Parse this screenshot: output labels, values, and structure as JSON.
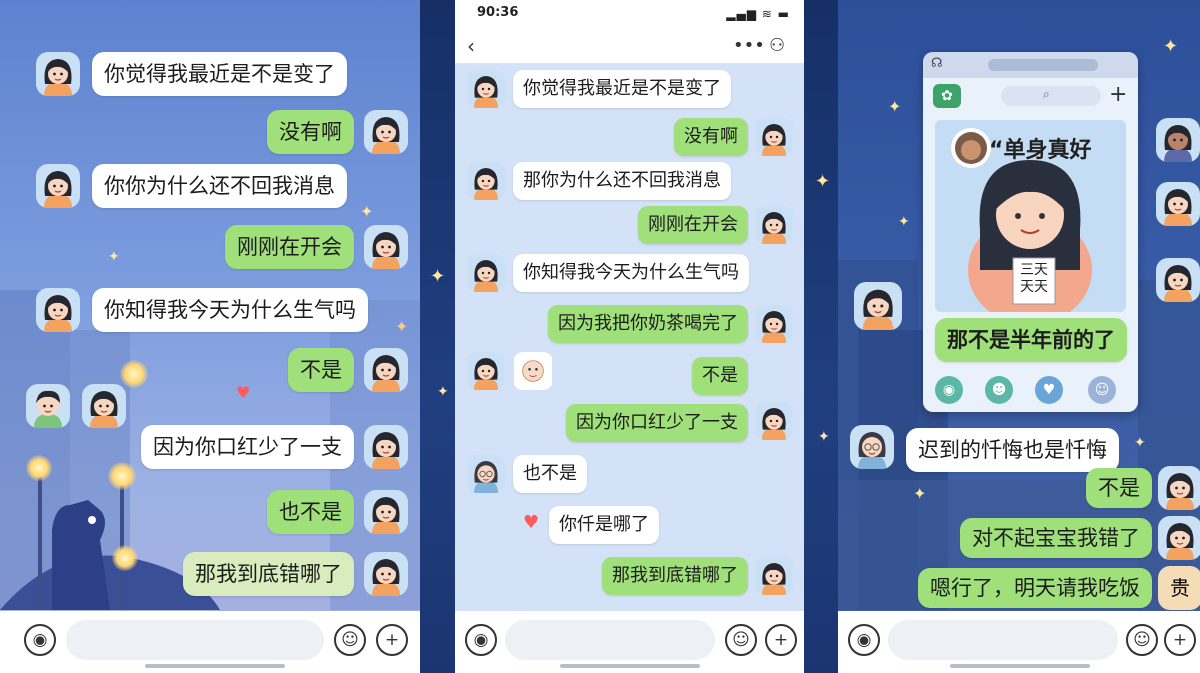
{
  "panel1": {
    "messages": [
      {
        "side": "in",
        "text": "你觉得我最近是不是变了"
      },
      {
        "side": "out",
        "text": "没有啊"
      },
      {
        "side": "in",
        "text": "你你为什么还不回我消息"
      },
      {
        "side": "out",
        "text": "刚刚在开会"
      },
      {
        "side": "in",
        "text": "你知得我今天为什么生气吗"
      },
      {
        "side": "out",
        "text": "不是"
      },
      {
        "side": "out",
        "text": "因为你口红少了一支"
      },
      {
        "side": "out",
        "text": "也不是"
      },
      {
        "side": "out",
        "text": "那我到底错哪了"
      }
    ]
  },
  "panel2": {
    "status_time": "90:36",
    "messages": [
      {
        "side": "in",
        "text": "你觉得我最近是不是变了"
      },
      {
        "side": "out",
        "text": "没有啊"
      },
      {
        "side": "in",
        "text": "那你为什么还不回我消息"
      },
      {
        "side": "out",
        "text": "刚刚在开会"
      },
      {
        "side": "in",
        "text": "你知得我今天为什么生气吗"
      },
      {
        "side": "out",
        "text": "因为我把你奶茶喝完了"
      },
      {
        "side": "out",
        "text": "不是"
      },
      {
        "side": "out",
        "text": "因为你口红少了一支"
      },
      {
        "side": "in",
        "text": "也不是"
      },
      {
        "side": "in",
        "text": "你仟是哪了"
      },
      {
        "side": "out",
        "text": "那我到底错哪了"
      }
    ]
  },
  "panel3": {
    "card": {
      "headline": "“单身真好",
      "sign_text": "三天\n天天",
      "reply": "那不是半年前的了"
    },
    "messages": [
      {
        "side": "in",
        "text": "迟到的忏悔也是忏悔"
      },
      {
        "side": "out",
        "text": "不是"
      },
      {
        "side": "out",
        "text": "对不起宝宝我错了"
      },
      {
        "side": "out",
        "text": "嗯行了，明天请我吃饭"
      }
    ],
    "avatar_badge": "贵"
  },
  "icons": {
    "voice": "voice-icon",
    "emoji": "emoji-icon",
    "plus": "plus-icon",
    "back": "back-icon",
    "more": "more-icon",
    "profile": "profile-icon"
  },
  "colors": {
    "outgoing_bubble": "#9fe07a",
    "incoming_bubble": "#ffffff",
    "accent_heart": "#ff5a5a"
  }
}
